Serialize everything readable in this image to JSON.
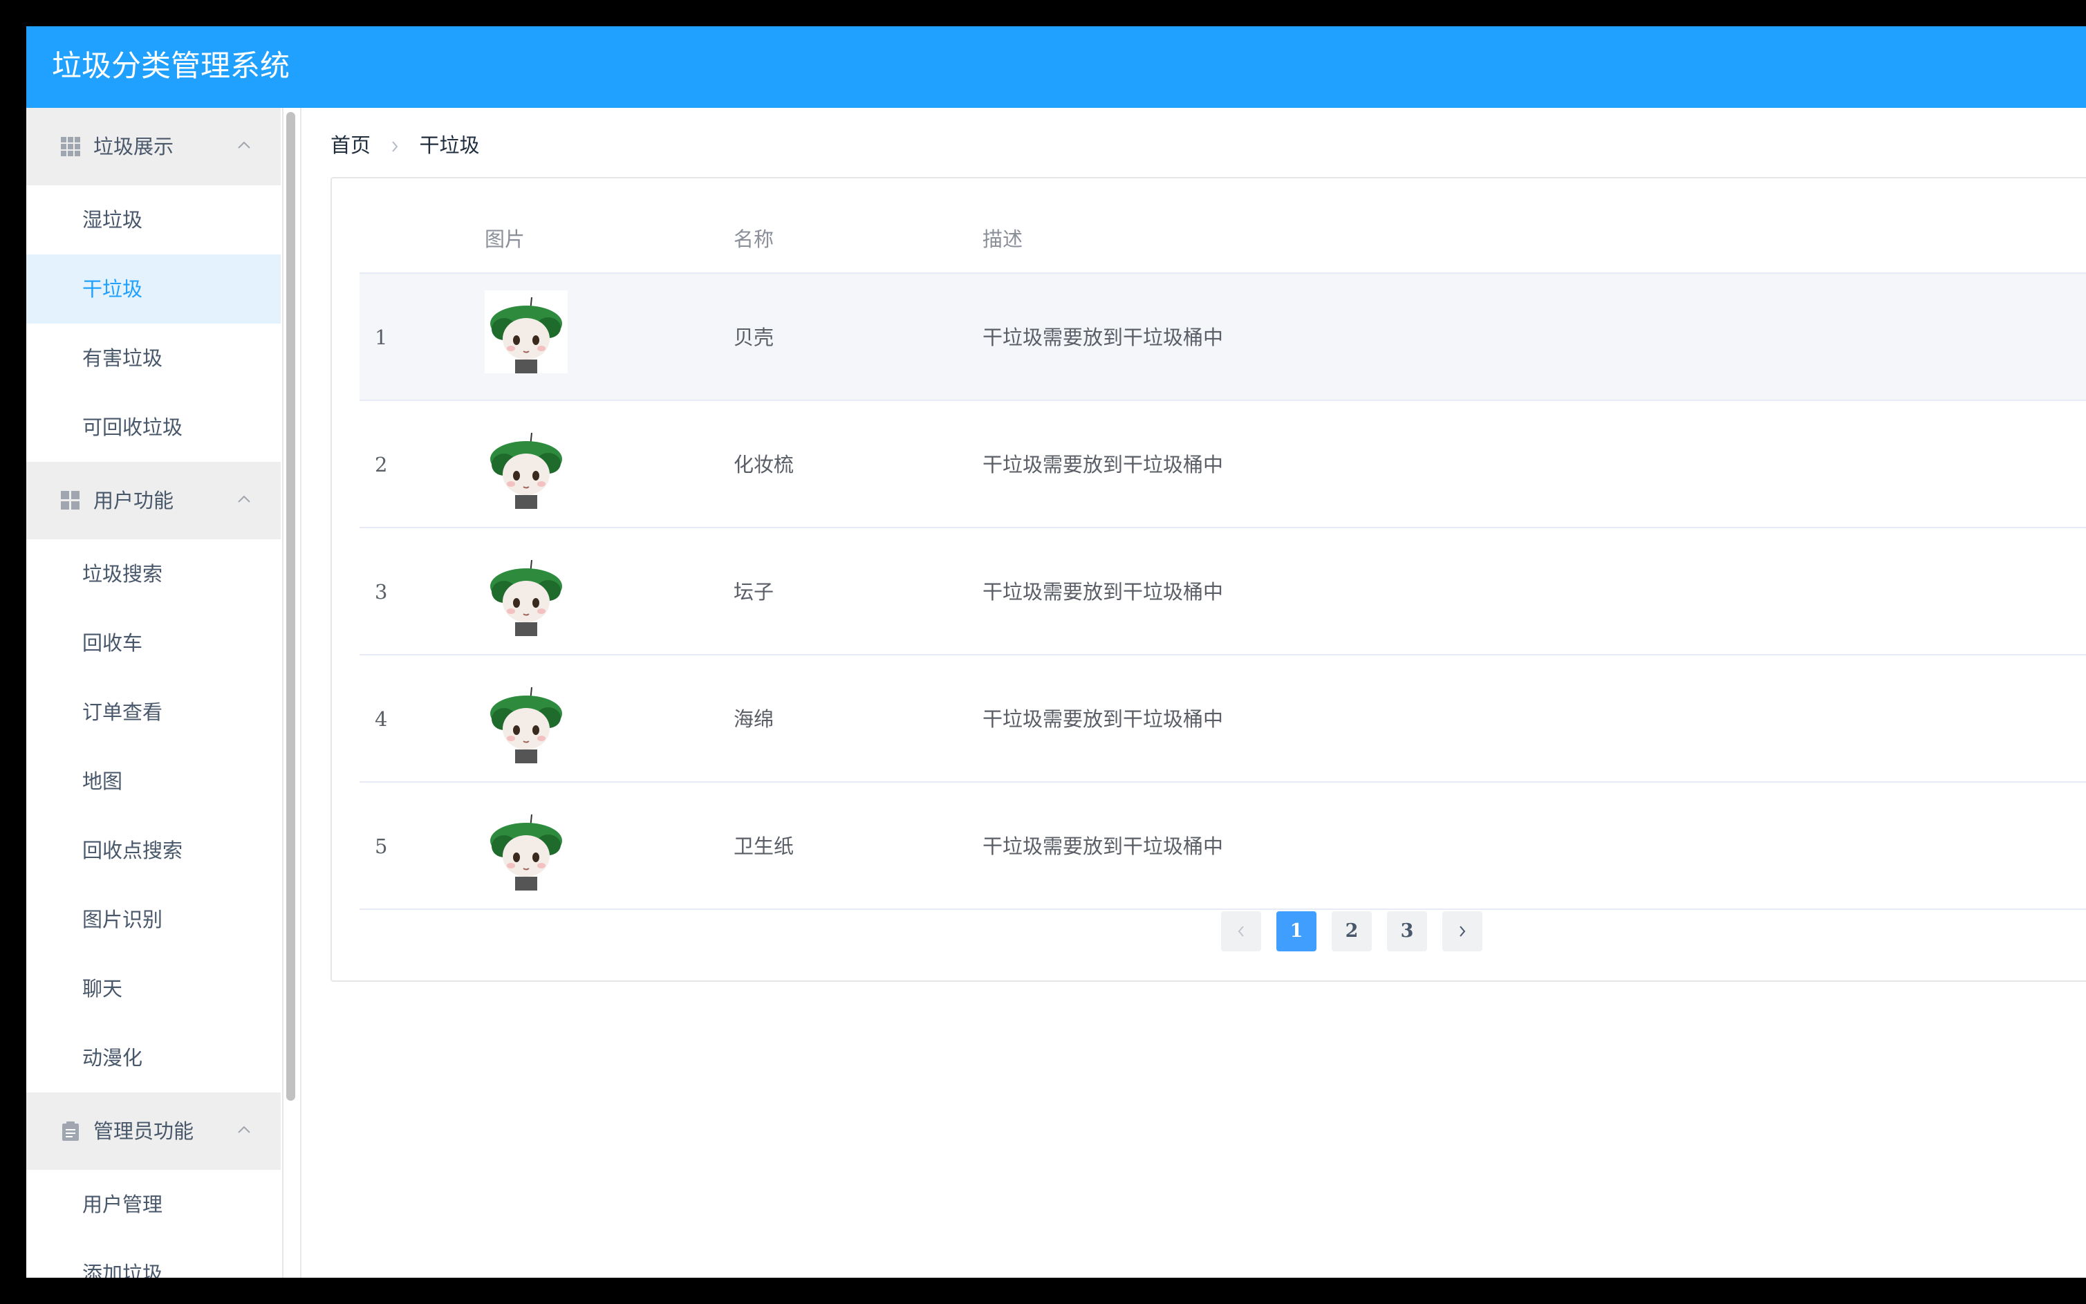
{
  "app": {
    "title": "垃圾分类管理系统"
  },
  "sidebar": {
    "groups": [
      {
        "label": "垃圾展示",
        "icon": "grid-icon",
        "items": [
          "湿垃圾",
          "干垃圾",
          "有害垃圾",
          "可回收垃圾"
        ]
      },
      {
        "label": "用户功能",
        "icon": "apps-icon",
        "items": [
          "垃圾搜索",
          "回收车",
          "订单查看",
          "地图",
          "回收点搜索",
          "图片识别",
          "聊天",
          "动漫化"
        ]
      },
      {
        "label": "管理员功能",
        "icon": "clipboard-icon",
        "items": [
          "用户管理",
          "添加垃圾"
        ]
      }
    ],
    "active_item": "干垃圾"
  },
  "breadcrumb": {
    "home": "首页",
    "current": "干垃圾"
  },
  "table": {
    "columns": [
      "图片",
      "名称",
      "描述"
    ],
    "rows": [
      {
        "index": "1",
        "name": "贝壳",
        "description": "干垃圾需要放到干垃圾桶中"
      },
      {
        "index": "2",
        "name": "化妆梳",
        "description": "干垃圾需要放到干垃圾桶中"
      },
      {
        "index": "3",
        "name": "坛子",
        "description": "干垃圾需要放到干垃圾桶中"
      },
      {
        "index": "4",
        "name": "海绵",
        "description": "干垃圾需要放到干垃圾桶中"
      },
      {
        "index": "5",
        "name": "卫生纸",
        "description": "干垃圾需要放到干垃圾桶中"
      }
    ]
  },
  "pagination": {
    "pages": [
      "1",
      "2",
      "3"
    ],
    "current": "1"
  },
  "colors": {
    "header": "#20a0ff",
    "active_text": "#20a0ff",
    "active_bg": "#e4f2fd",
    "page_active": "#409eff"
  }
}
